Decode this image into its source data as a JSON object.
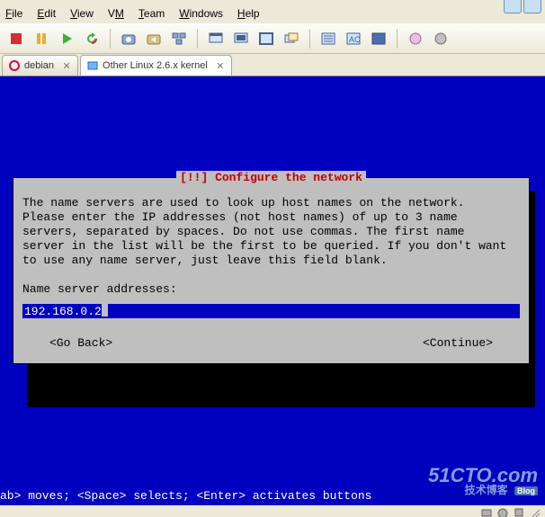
{
  "menu": {
    "file": "File",
    "edit": "Edit",
    "view": "View",
    "vm": "VM",
    "team": "Team",
    "windows": "Windows",
    "help": "Help"
  },
  "tabs": {
    "t0": {
      "label": "debian"
    },
    "t1": {
      "label": "Other Linux 2.6.x kernel"
    }
  },
  "dialog": {
    "title": "[!!] Configure the network",
    "body": "The name servers are used to look up host names on the network.\nPlease enter the IP addresses (not host names) of up to 3 name\nservers, separated by spaces. Do not use commas. The first name\nserver in the list will be the first to be queried. If you don't want\nto use any name server, just leave this field blank.",
    "prompt": "Name server addresses:",
    "input_value": "192.168.0.2",
    "go_back": "<Go Back>",
    "cont": "<Continue>"
  },
  "hint": "ab> moves; <Space> selects; <Enter> activates buttons",
  "watermark": {
    "line1": "51CTO.com",
    "line2": "技术博客",
    "badge": "Blog"
  },
  "icons": {
    "stop": "stop-icon",
    "pause": "pause-icon",
    "play": "play-icon",
    "restart": "restart-icon",
    "snapshot": "snapshot-icon",
    "revert": "revert-icon",
    "snapmgr": "snapshot-manager-icon",
    "fit_guest": "show-console-icon",
    "fit_window": "fit-window-icon",
    "full": "fullscreen-icon",
    "unity": "unity-icon",
    "summary": "summary-icon",
    "appliance": "appliance-icon",
    "console": "console-icon",
    "quick_switch1": "quick-switch-icon",
    "quick_switch2": "quick-switch-icon"
  }
}
